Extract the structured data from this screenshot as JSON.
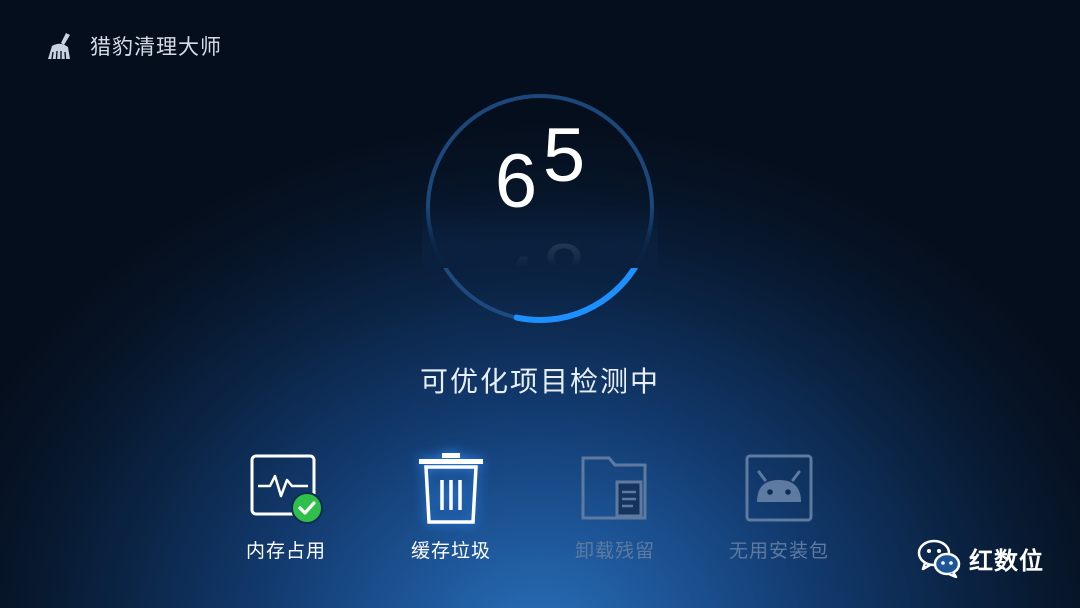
{
  "app": {
    "title": "猎豹清理大师",
    "logo_icon": "broom-icon"
  },
  "scan": {
    "progress_fraction": 0.2,
    "counter_visible": "65",
    "counter_next": "48",
    "status": "可优化项目检测中",
    "accent_color": "#1e8fff"
  },
  "items": [
    {
      "label": "内存占用",
      "icon": "memory-monitor-icon",
      "state": "done"
    },
    {
      "label": "缓存垃圾",
      "icon": "trash-can-icon",
      "state": "scanning"
    },
    {
      "label": "卸载残留",
      "icon": "folder-document-icon",
      "state": "pending"
    },
    {
      "label": "无用安装包",
      "icon": "android-package-icon",
      "state": "pending"
    }
  ],
  "watermark": {
    "text": "红数位",
    "icon": "wechat-icon"
  }
}
